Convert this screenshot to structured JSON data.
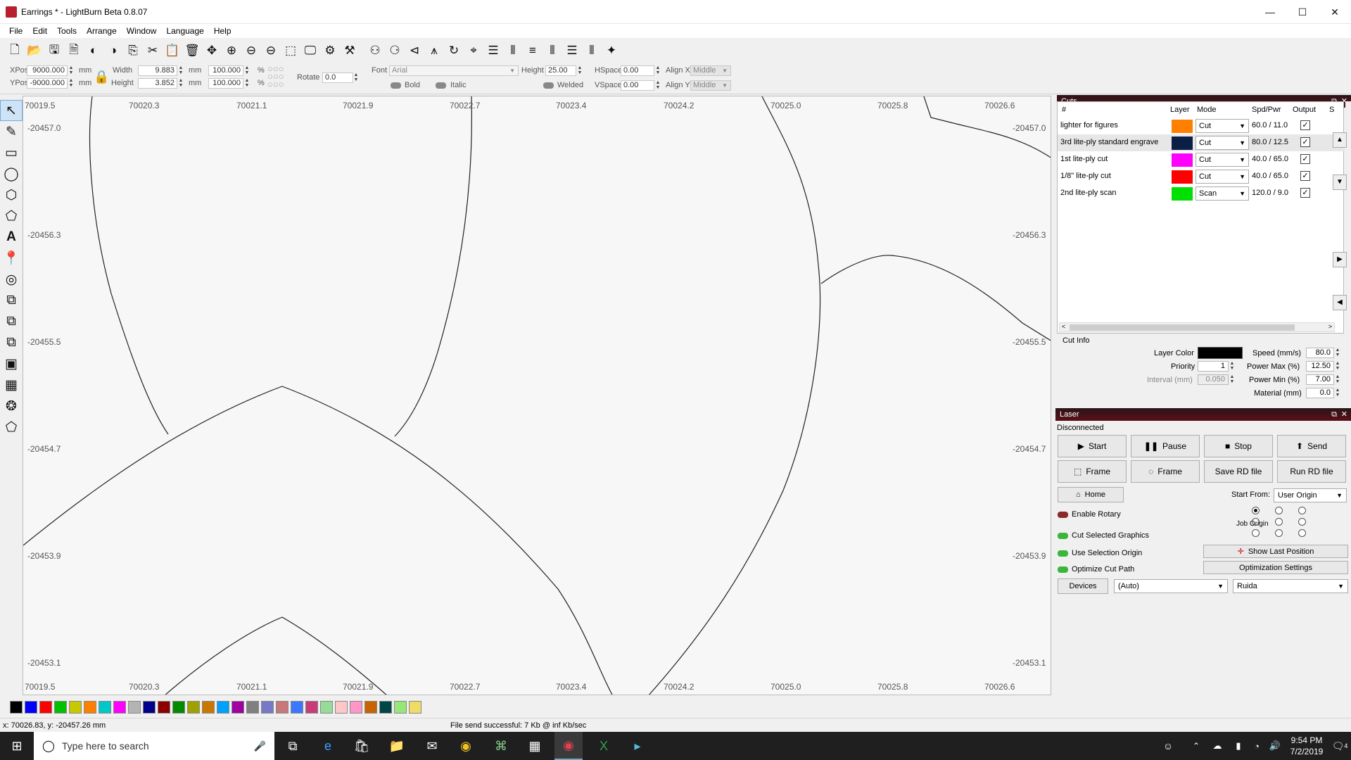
{
  "window": {
    "title": "Earrings * - LightBurn Beta 0.8.07"
  },
  "menu": [
    "File",
    "Edit",
    "Tools",
    "Arrange",
    "Window",
    "Language",
    "Help"
  ],
  "props": {
    "xpos_label": "XPos",
    "xpos": "9000.000",
    "ypos_label": "YPos",
    "ypos": "-9000.000",
    "unit": "mm",
    "width_label": "Width",
    "width": "9.883",
    "height_label": "Height",
    "height": "3.852",
    "wpct": "100.000",
    "hpct": "100.000",
    "pct": "%",
    "rotate_label": "Rotate",
    "rotate": "0.0",
    "font_label": "Font",
    "font": "Arial",
    "fheight_label": "Height",
    "fheight": "25.00",
    "hspace_label": "HSpace",
    "hspace": "0.00",
    "vspace_label": "VSpace",
    "vspace": "0.00",
    "alignx_label": "Align X",
    "alignx": "Middle",
    "aligny_label": "Align Y",
    "aligny": "Middle",
    "bold": "Bold",
    "italic": "Italic",
    "welded": "Welded"
  },
  "ruler": {
    "top": [
      "70019.5",
      "70020.3",
      "70021.1",
      "70021.9",
      "70022.7",
      "70023.4",
      "70024.2",
      "70025.0",
      "70025.8",
      "70026.6"
    ],
    "left": [
      "-20457.0",
      "-20456.3",
      "-20455.5",
      "-20454.7",
      "-20453.9",
      "-20453.1"
    ]
  },
  "cuts": {
    "title": "Cuts",
    "headers": {
      "num": "#",
      "layer": "Layer",
      "mode": "Mode",
      "spdpwr": "Spd/Pwr",
      "output": "Output",
      "s": "S"
    },
    "rows": [
      {
        "name": "lighter for figures",
        "color": "#ff8000",
        "mode": "Cut",
        "sp": "60.0 / 11.0",
        "out": "✓"
      },
      {
        "name": "3rd lite-ply standard engrave",
        "color": "#0a1e46",
        "mode": "Cut",
        "sp": "80.0 / 12.5",
        "out": "✓"
      },
      {
        "name": "1st lite-ply cut",
        "color": "#ff00ff",
        "mode": "Cut",
        "sp": "40.0 / 65.0",
        "out": "✓"
      },
      {
        "name": "1/8\" lite-ply cut",
        "color": "#ff0000",
        "mode": "Cut",
        "sp": "40.0 / 65.0",
        "out": "✓"
      },
      {
        "name": "2nd lite-ply scan",
        "color": "#00e000",
        "mode": "Scan",
        "sp": "120.0 / 9.0",
        "out": "✓"
      }
    ]
  },
  "cutinfo": {
    "title": "Cut Info",
    "layer_color": "Layer Color",
    "priority": "Priority",
    "priority_val": "1",
    "interval": "Interval (mm)",
    "interval_val": "0.050",
    "speed": "Speed (mm/s)",
    "speed_val": "80.0",
    "pmax": "Power Max (%)",
    "pmax_val": "12.50",
    "pmin": "Power Min (%)",
    "pmin_val": "7.00",
    "material": "Material (mm)",
    "material_val": "0.0"
  },
  "laser": {
    "title": "Laser",
    "status": "Disconnected",
    "start": "Start",
    "pause": "Pause",
    "stop": "Stop",
    "send": "Send",
    "frame1": "Frame",
    "frame2": "Frame",
    "save_rd": "Save RD file",
    "run_rd": "Run RD file",
    "home": "Home",
    "start_from": "Start From:",
    "start_from_val": "User Origin",
    "enable_rotary": "Enable Rotary",
    "job_origin": "Job Origin",
    "cut_selected": "Cut Selected Graphics",
    "use_sel_origin": "Use Selection Origin",
    "optimize": "Optimize Cut Path",
    "show_last": "Show Last Position",
    "opt_settings": "Optimization Settings",
    "devices": "Devices",
    "device_val": "(Auto)",
    "controller": "Ruida"
  },
  "palette": [
    "#000000",
    "#0000ff",
    "#ff0000",
    "#00c000",
    "#c8c800",
    "#ff8000",
    "#00c8c8",
    "#ff00ff",
    "#b4b4b4",
    "#00008c",
    "#8c0000",
    "#008c00",
    "#a0a000",
    "#c87800",
    "#00a0ff",
    "#a000a0",
    "#808080",
    "#7878c8",
    "#c87878",
    "#3c78ff",
    "#c83c78",
    "#96dc96",
    "#ffc8c8",
    "#ff96c8",
    "#c86400",
    "#004646",
    "#96e678",
    "#f0dc64"
  ],
  "status": {
    "coords": "x: 70026.83, y: -20457.26 mm",
    "message": "File send successful: 7 Kb @ inf Kb/sec"
  },
  "taskbar": {
    "search": "Type here to search",
    "time": "9:54 PM",
    "date": "7/2/2019",
    "notif": "4"
  }
}
